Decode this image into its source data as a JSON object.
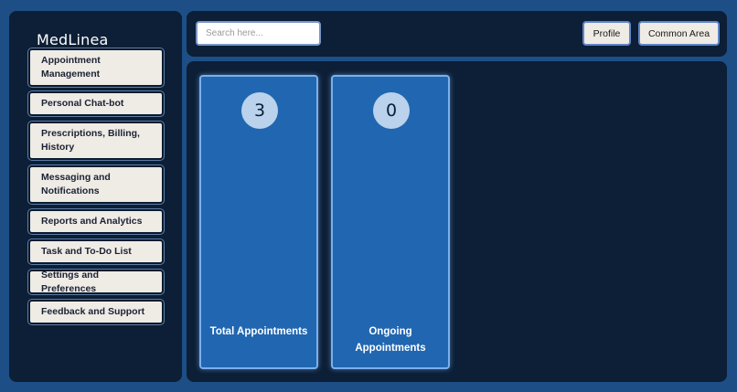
{
  "sidebar": {
    "brand": "MedLinea",
    "items": [
      {
        "label": "Appointment Management"
      },
      {
        "label": "Personal Chat-bot"
      },
      {
        "label": "Prescriptions, Billing, History"
      },
      {
        "label": "Messaging and Notifications"
      },
      {
        "label": "Reports and Analytics"
      },
      {
        "label": "Task and To-Do List"
      },
      {
        "label": "Settings and Preferences"
      },
      {
        "label": "Feedback and Support"
      }
    ]
  },
  "header": {
    "search_placeholder": "Search here...",
    "profile_label": "Profile",
    "common_area_label": "Common Area"
  },
  "stats": [
    {
      "value": "3",
      "label": "Total Appointments"
    },
    {
      "value": "0",
      "label": "Ongoing Appointments"
    }
  ],
  "colors": {
    "page_bg": "#1d4f86",
    "panel_bg": "#0c1f36",
    "card_bg": "#2166b0",
    "button_bg": "#efebe5"
  }
}
